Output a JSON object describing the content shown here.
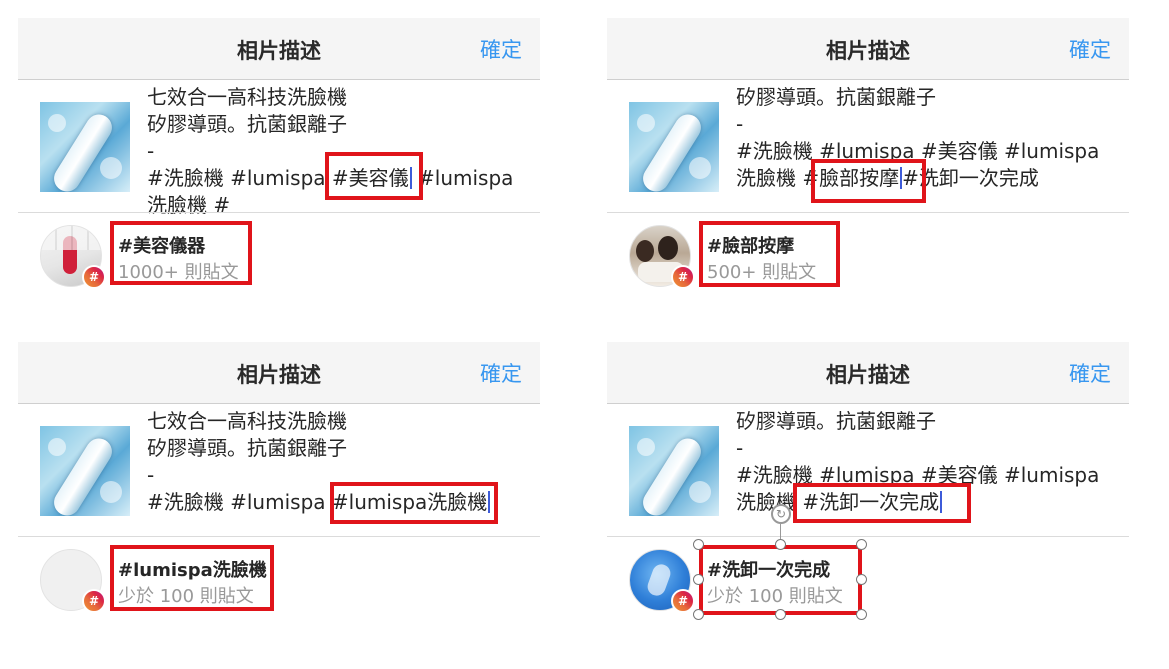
{
  "panels": [
    {
      "nav": {
        "title": "相片描述",
        "confirm": "確定"
      },
      "caption": {
        "line1": "七效合一高科技洗臉機",
        "line2": "矽膠導頭。抗菌銀離子",
        "line3": "-",
        "line4_before": "#洗臉機 #lumispa ",
        "line4_current": "#美容儀",
        "line4_after": " #lumispa",
        "line5": "洗臉機 #"
      },
      "suggestion": {
        "name": "#美容儀器",
        "count": "1000+ 則貼文",
        "avatar": "beauty-device-photo"
      }
    },
    {
      "nav": {
        "title": "相片描述",
        "confirm": "確定"
      },
      "caption": {
        "line1": "矽膠導頭。抗菌銀離子",
        "line2": "-",
        "line3": "#洗臉機 #lumispa #美容儀 #lumispa",
        "line4_before": "洗臉機 ",
        "line4_current": "#臉部按摩",
        "line4_after": "#洗卸一次完成"
      },
      "suggestion": {
        "name": "#臉部按摩",
        "count": "500+ 則貼文",
        "avatar": "facial-massage-photo"
      }
    },
    {
      "nav": {
        "title": "相片描述",
        "confirm": "確定"
      },
      "caption": {
        "line1": "七效合一高科技洗臉機",
        "line2": "矽膠導頭。抗菌銀離子",
        "line3": "-",
        "line4_before": "#洗臉機 #lumispa ",
        "line4_current": "#lumispa洗臉機",
        "line4_after": ""
      },
      "suggestion": {
        "name": "#lumispa洗臉機",
        "count": "少於 100 則貼文",
        "avatar": "empty-avatar"
      }
    },
    {
      "nav": {
        "title": "相片描述",
        "confirm": "確定"
      },
      "caption": {
        "line1": "矽膠導頭。抗菌銀離子",
        "line2": "-",
        "line3": "#洗臉機 #lumispa #美容儀 #lumispa",
        "line4_before": "洗臉機 ",
        "line4_current": "#洗卸一次完成",
        "line4_after": ""
      },
      "suggestion": {
        "name": "#洗卸一次完成",
        "count": "少於 100 則貼文",
        "avatar": "blue-splash-photo"
      }
    }
  ],
  "colors": {
    "accent": "#3897f0",
    "highlight": "#e0141a",
    "caret": "#3d5bd9"
  }
}
